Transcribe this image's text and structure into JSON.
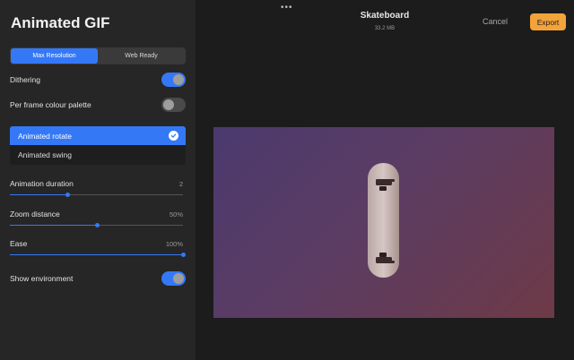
{
  "panel": {
    "title": "Animated GIF",
    "segmented": {
      "options": [
        "Max Resolution",
        "Web Ready"
      ],
      "selected": "Max Resolution"
    },
    "dithering": {
      "label": "Dithering",
      "on": true
    },
    "per_frame_palette": {
      "label": "Per frame colour palette",
      "on": false
    },
    "animation_options": [
      {
        "label": "Animated rotate",
        "selected": true
      },
      {
        "label": "Animated swing",
        "selected": false
      }
    ],
    "animation_duration": {
      "label": "Animation duration",
      "value": "2",
      "fraction": 0.33
    },
    "zoom_distance": {
      "label": "Zoom distance",
      "value": "50%",
      "fraction": 0.5
    },
    "ease": {
      "label": "Ease",
      "value": "100%",
      "fraction": 1.0
    },
    "show_environment": {
      "label": "Show environment",
      "on": true
    }
  },
  "header": {
    "menu_dots": "•••",
    "title": "Skateboard",
    "size": "33.2 MB",
    "cancel_label": "Cancel",
    "export_label": "Export"
  },
  "colors": {
    "accent": "#3478f6",
    "export": "#f3a33a"
  }
}
